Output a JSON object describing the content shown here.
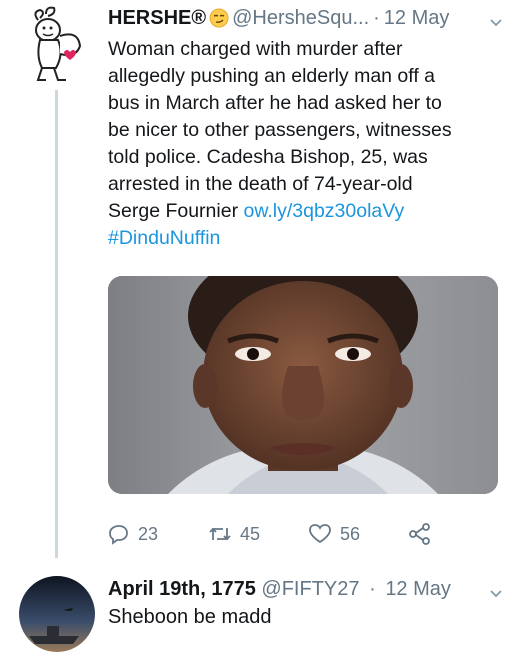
{
  "tweet": {
    "author_name": "HERSHE®",
    "author_emoji": "smirk-emoji",
    "handle": "@HersheSqu...",
    "separator": "·",
    "time": "12 May",
    "text_lines": [
      "Woman charged with murder after",
      "allegedly pushing an elderly man off a",
      "bus in March after he had asked her to",
      "be nicer to other passengers, witnesses",
      "told police. Cadesha Bishop, 25, was",
      "arrested in the death of 74-year-old"
    ],
    "last_line_text": "Serge Fournier ",
    "link": "ow.ly/3qbz30olaVy",
    "hashtag": "#DinduNuffin",
    "media": "photo-of-woman",
    "actions": {
      "reply_count": "23",
      "retweet_count": "45",
      "like_count": "56"
    },
    "icons": [
      "reply-icon",
      "retweet-icon",
      "like-icon",
      "share-icon",
      "chevron-down-icon"
    ]
  },
  "reply": {
    "author_name": "April 19th, 1775",
    "handle": "@FIFTY27",
    "separator": "·",
    "time": "12 May",
    "text": "Sheboon be madd"
  },
  "colors": {
    "link": "#1b95e0",
    "muted": "#657786",
    "text": "#14171a",
    "thread_line": "#ccd6dd"
  }
}
